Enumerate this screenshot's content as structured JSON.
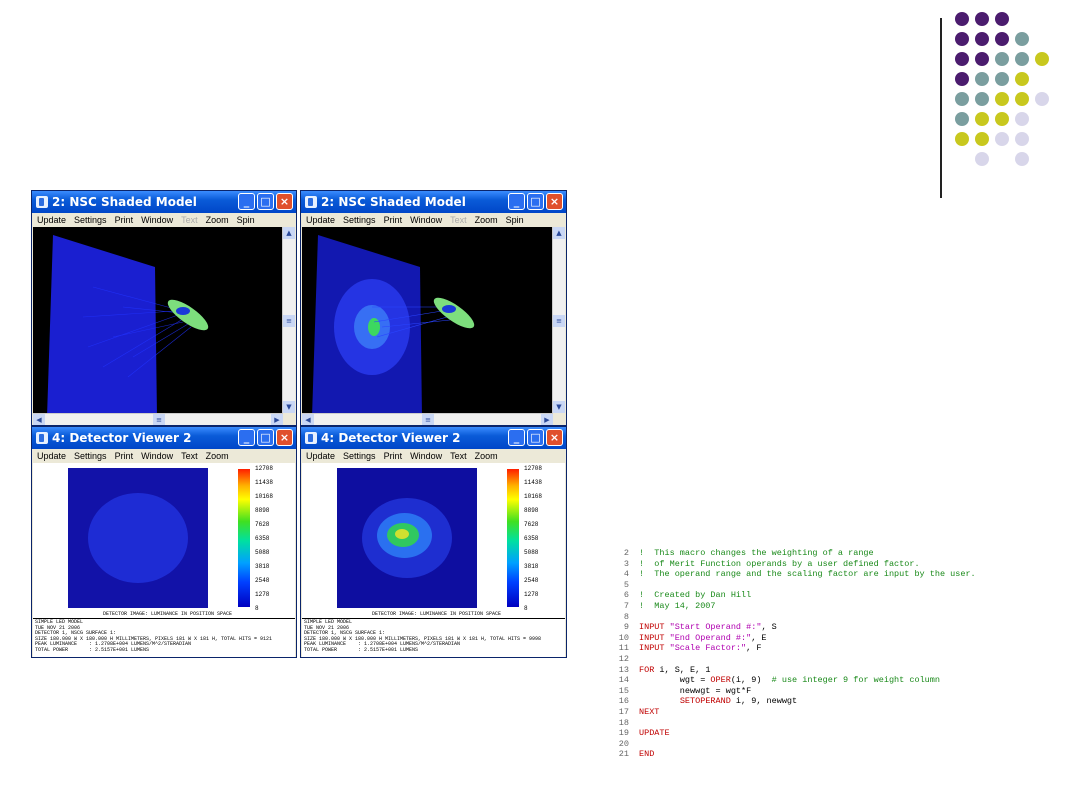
{
  "decor": {
    "dot_colors": [
      "#4b1c6e",
      "#7a9e9f",
      "#c8c81e",
      "#d8d6ea"
    ],
    "rule_color": "#222222"
  },
  "windows": [
    {
      "title": "2: NSC Shaded Model",
      "menu": [
        "Update",
        "Settings",
        "Print",
        "Window",
        "Text",
        "Zoom",
        "Spin"
      ],
      "disabled_menu": "Text",
      "type": "shaded"
    },
    {
      "title": "2: NSC Shaded Model",
      "menu": [
        "Update",
        "Settings",
        "Print",
        "Window",
        "Text",
        "Zoom",
        "Spin"
      ],
      "disabled_menu": "Text",
      "type": "shaded"
    },
    {
      "title": "4: Detector Viewer 2",
      "menu": [
        "Update",
        "Settings",
        "Print",
        "Window",
        "Text",
        "Zoom"
      ],
      "type": "detector",
      "caption": "DETECTOR IMAGE: LUMINANCE IN POSITION SPACE",
      "footer_lines": [
        "SIMPLE LED MODEL",
        "TUE NOV 21 2006",
        "DETECTOR 1, NSCG SURFACE 1:",
        "SIZE 180.000 W X 180.000 H MILLIMETERS, PIXELS 181 W X 181 H, TOTAL HITS = 9121",
        "PEAK LUMINANCE    : 1.2708E+004 LUMENS/M^2/STERADIAN",
        "TOTAL POWER       : 2.5157E+001 LUMENS"
      ]
    },
    {
      "title": "4: Detector Viewer 2",
      "menu": [
        "Update",
        "Settings",
        "Print",
        "Window",
        "Text",
        "Zoom"
      ],
      "type": "detector",
      "caption": "DETECTOR IMAGE: LUMINANCE IN POSITION SPACE",
      "footer_lines": [
        "SIMPLE LED MODEL",
        "TUE NOV 21 2006",
        "DETECTOR 1, NSCG SURFACE 1:",
        "SIZE 180.000 W X 180.000 H MILLIMETERS, PIXELS 181 W X 181 H, TOTAL HITS = 9998",
        "PEAK LUMINANCE    : 1.2708E+004 LUMENS/M^2/STERADIAN",
        "TOTAL POWER       : 2.5157E+001 LUMENS"
      ]
    }
  ],
  "colorbar_labels": [
    "12708",
    "11438",
    "10168",
    "8898",
    "7628",
    "6358",
    "5088",
    "3818",
    "2548",
    "1278",
    "8"
  ],
  "code_lines": [
    {
      "n": "2",
      "parts": [
        {
          "t": "!  This macro changes the weighting of a range",
          "c": "comment"
        }
      ]
    },
    {
      "n": "3",
      "parts": [
        {
          "t": "!  of Merit Function operands by a user defined factor.",
          "c": "comment"
        }
      ]
    },
    {
      "n": "4",
      "parts": [
        {
          "t": "!  The operand range and the scaling factor are input by the user.",
          "c": "comment"
        }
      ]
    },
    {
      "n": "5",
      "parts": []
    },
    {
      "n": "6",
      "parts": [
        {
          "t": "!  Created by Dan Hill",
          "c": "comment"
        }
      ]
    },
    {
      "n": "7",
      "parts": [
        {
          "t": "!  May 14, 2007",
          "c": "comment"
        }
      ]
    },
    {
      "n": "8",
      "parts": []
    },
    {
      "n": "9",
      "parts": [
        {
          "t": "INPUT ",
          "c": "kw"
        },
        {
          "t": "\"Start Operand #:\"",
          "c": "str"
        },
        {
          "t": ", S",
          "c": "plain"
        }
      ]
    },
    {
      "n": "10",
      "parts": [
        {
          "t": "INPUT ",
          "c": "kw"
        },
        {
          "t": "\"End Operand #:\"",
          "c": "str"
        },
        {
          "t": ", E",
          "c": "plain"
        }
      ]
    },
    {
      "n": "11",
      "parts": [
        {
          "t": "INPUT ",
          "c": "kw"
        },
        {
          "t": "\"Scale Factor:\"",
          "c": "str"
        },
        {
          "t": ", F",
          "c": "plain"
        }
      ]
    },
    {
      "n": "12",
      "parts": []
    },
    {
      "n": "13",
      "parts": [
        {
          "t": "FOR ",
          "c": "kw"
        },
        {
          "t": "i, S, E, 1",
          "c": "plain"
        }
      ]
    },
    {
      "n": "14",
      "parts": [
        {
          "t": "        wgt = ",
          "c": "plain"
        },
        {
          "t": "OPER",
          "c": "kw"
        },
        {
          "t": "(i, 9)  ",
          "c": "plain"
        },
        {
          "t": "# use integer 9 for weight column",
          "c": "comment"
        }
      ]
    },
    {
      "n": "15",
      "parts": [
        {
          "t": "        newwgt = wgt*F",
          "c": "plain"
        }
      ]
    },
    {
      "n": "16",
      "parts": [
        {
          "t": "        ",
          "c": "plain"
        },
        {
          "t": "SETOPERAND ",
          "c": "kw"
        },
        {
          "t": "i, 9, newwgt",
          "c": "plain"
        }
      ]
    },
    {
      "n": "17",
      "parts": [
        {
          "t": "NEXT",
          "c": "kw"
        }
      ]
    },
    {
      "n": "18",
      "parts": []
    },
    {
      "n": "19",
      "parts": [
        {
          "t": "UPDATE",
          "c": "kw"
        }
      ]
    },
    {
      "n": "20",
      "parts": []
    },
    {
      "n": "21",
      "parts": [
        {
          "t": "END",
          "c": "kw"
        }
      ]
    }
  ]
}
